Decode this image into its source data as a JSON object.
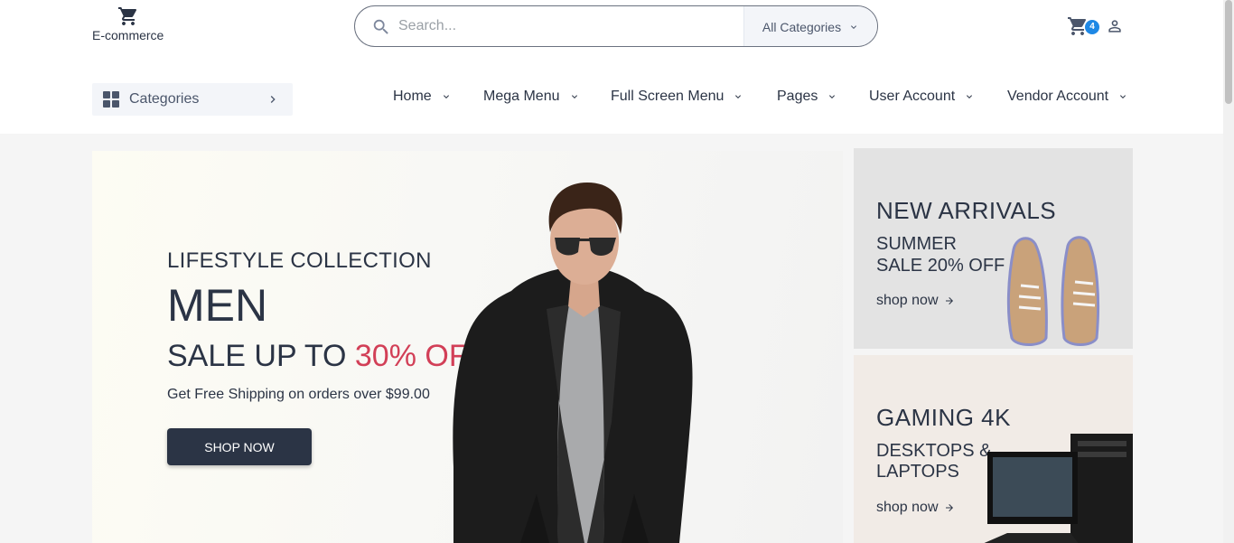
{
  "header": {
    "logo_text": "E-commerce",
    "search": {
      "placeholder": "Search...",
      "category_label": "All Categories"
    },
    "cart_count": "4"
  },
  "nav": {
    "categories_label": "Categories",
    "items": [
      {
        "label": "Home"
      },
      {
        "label": "Mega Menu"
      },
      {
        "label": "Full Screen Menu"
      },
      {
        "label": "Pages"
      },
      {
        "label": "User Account"
      },
      {
        "label": "Vendor Account"
      }
    ]
  },
  "hero": {
    "subtitle": "LIFESTYLE COLLECTION",
    "title": "MEN",
    "sale_prefix": "SALE UP TO ",
    "sale_percent": "30% OFF",
    "shipping": "Get Free Shipping on orders over $99.00",
    "button_label": "SHOP NOW"
  },
  "promos": [
    {
      "heading": "NEW ARRIVALS",
      "line1": "SUMMER",
      "line2": "SALE 20% OFF",
      "link": "shop now"
    },
    {
      "heading": "GAMING 4K",
      "line1": "DESKTOPS &",
      "line2": "LAPTOPS",
      "link": "shop now"
    }
  ],
  "colors": {
    "accent": "#d23f57",
    "dark": "#2b3445",
    "badge": "#1e88e5"
  },
  "icons": [
    "cart-icon",
    "search-icon",
    "chevron-down-icon",
    "user-icon",
    "grid-icon",
    "chevron-right-icon",
    "arrow-right-icon"
  ]
}
